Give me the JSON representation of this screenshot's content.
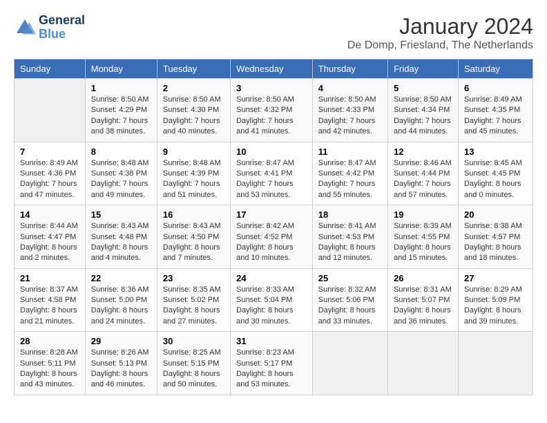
{
  "logo": {
    "line1": "General",
    "line2": "Blue"
  },
  "title": "January 2024",
  "subtitle": "De Domp, Friesland, The Netherlands",
  "days_of_week": [
    "Sunday",
    "Monday",
    "Tuesday",
    "Wednesday",
    "Thursday",
    "Friday",
    "Saturday"
  ],
  "weeks": [
    [
      {
        "num": "",
        "sunrise": "",
        "sunset": "",
        "daylight": ""
      },
      {
        "num": "1",
        "sunrise": "Sunrise: 8:50 AM",
        "sunset": "Sunset: 4:29 PM",
        "daylight": "Daylight: 7 hours and 38 minutes."
      },
      {
        "num": "2",
        "sunrise": "Sunrise: 8:50 AM",
        "sunset": "Sunset: 4:30 PM",
        "daylight": "Daylight: 7 hours and 40 minutes."
      },
      {
        "num": "3",
        "sunrise": "Sunrise: 8:50 AM",
        "sunset": "Sunset: 4:32 PM",
        "daylight": "Daylight: 7 hours and 41 minutes."
      },
      {
        "num": "4",
        "sunrise": "Sunrise: 8:50 AM",
        "sunset": "Sunset: 4:33 PM",
        "daylight": "Daylight: 7 hours and 42 minutes."
      },
      {
        "num": "5",
        "sunrise": "Sunrise: 8:50 AM",
        "sunset": "Sunset: 4:34 PM",
        "daylight": "Daylight: 7 hours and 44 minutes."
      },
      {
        "num": "6",
        "sunrise": "Sunrise: 8:49 AM",
        "sunset": "Sunset: 4:35 PM",
        "daylight": "Daylight: 7 hours and 45 minutes."
      }
    ],
    [
      {
        "num": "7",
        "sunrise": "Sunrise: 8:49 AM",
        "sunset": "Sunset: 4:36 PM",
        "daylight": "Daylight: 7 hours and 47 minutes."
      },
      {
        "num": "8",
        "sunrise": "Sunrise: 8:48 AM",
        "sunset": "Sunset: 4:38 PM",
        "daylight": "Daylight: 7 hours and 49 minutes."
      },
      {
        "num": "9",
        "sunrise": "Sunrise: 8:48 AM",
        "sunset": "Sunset: 4:39 PM",
        "daylight": "Daylight: 7 hours and 51 minutes."
      },
      {
        "num": "10",
        "sunrise": "Sunrise: 8:47 AM",
        "sunset": "Sunset: 4:41 PM",
        "daylight": "Daylight: 7 hours and 53 minutes."
      },
      {
        "num": "11",
        "sunrise": "Sunrise: 8:47 AM",
        "sunset": "Sunset: 4:42 PM",
        "daylight": "Daylight: 7 hours and 55 minutes."
      },
      {
        "num": "12",
        "sunrise": "Sunrise: 8:46 AM",
        "sunset": "Sunset: 4:44 PM",
        "daylight": "Daylight: 7 hours and 57 minutes."
      },
      {
        "num": "13",
        "sunrise": "Sunrise: 8:45 AM",
        "sunset": "Sunset: 4:45 PM",
        "daylight": "Daylight: 8 hours and 0 minutes."
      }
    ],
    [
      {
        "num": "14",
        "sunrise": "Sunrise: 8:44 AM",
        "sunset": "Sunset: 4:47 PM",
        "daylight": "Daylight: 8 hours and 2 minutes."
      },
      {
        "num": "15",
        "sunrise": "Sunrise: 8:43 AM",
        "sunset": "Sunset: 4:48 PM",
        "daylight": "Daylight: 8 hours and 4 minutes."
      },
      {
        "num": "16",
        "sunrise": "Sunrise: 8:43 AM",
        "sunset": "Sunset: 4:50 PM",
        "daylight": "Daylight: 8 hours and 7 minutes."
      },
      {
        "num": "17",
        "sunrise": "Sunrise: 8:42 AM",
        "sunset": "Sunset: 4:52 PM",
        "daylight": "Daylight: 8 hours and 10 minutes."
      },
      {
        "num": "18",
        "sunrise": "Sunrise: 8:41 AM",
        "sunset": "Sunset: 4:53 PM",
        "daylight": "Daylight: 8 hours and 12 minutes."
      },
      {
        "num": "19",
        "sunrise": "Sunrise: 8:39 AM",
        "sunset": "Sunset: 4:55 PM",
        "daylight": "Daylight: 8 hours and 15 minutes."
      },
      {
        "num": "20",
        "sunrise": "Sunrise: 8:38 AM",
        "sunset": "Sunset: 4:57 PM",
        "daylight": "Daylight: 8 hours and 18 minutes."
      }
    ],
    [
      {
        "num": "21",
        "sunrise": "Sunrise: 8:37 AM",
        "sunset": "Sunset: 4:58 PM",
        "daylight": "Daylight: 8 hours and 21 minutes."
      },
      {
        "num": "22",
        "sunrise": "Sunrise: 8:36 AM",
        "sunset": "Sunset: 5:00 PM",
        "daylight": "Daylight: 8 hours and 24 minutes."
      },
      {
        "num": "23",
        "sunrise": "Sunrise: 8:35 AM",
        "sunset": "Sunset: 5:02 PM",
        "daylight": "Daylight: 8 hours and 27 minutes."
      },
      {
        "num": "24",
        "sunrise": "Sunrise: 8:33 AM",
        "sunset": "Sunset: 5:04 PM",
        "daylight": "Daylight: 8 hours and 30 minutes."
      },
      {
        "num": "25",
        "sunrise": "Sunrise: 8:32 AM",
        "sunset": "Sunset: 5:06 PM",
        "daylight": "Daylight: 8 hours and 33 minutes."
      },
      {
        "num": "26",
        "sunrise": "Sunrise: 8:31 AM",
        "sunset": "Sunset: 5:07 PM",
        "daylight": "Daylight: 8 hours and 36 minutes."
      },
      {
        "num": "27",
        "sunrise": "Sunrise: 8:29 AM",
        "sunset": "Sunset: 5:09 PM",
        "daylight": "Daylight: 8 hours and 39 minutes."
      }
    ],
    [
      {
        "num": "28",
        "sunrise": "Sunrise: 8:28 AM",
        "sunset": "Sunset: 5:11 PM",
        "daylight": "Daylight: 8 hours and 43 minutes."
      },
      {
        "num": "29",
        "sunrise": "Sunrise: 8:26 AM",
        "sunset": "Sunset: 5:13 PM",
        "daylight": "Daylight: 8 hours and 46 minutes."
      },
      {
        "num": "30",
        "sunrise": "Sunrise: 8:25 AM",
        "sunset": "Sunset: 5:15 PM",
        "daylight": "Daylight: 8 hours and 50 minutes."
      },
      {
        "num": "31",
        "sunrise": "Sunrise: 8:23 AM",
        "sunset": "Sunset: 5:17 PM",
        "daylight": "Daylight: 8 hours and 53 minutes."
      },
      {
        "num": "",
        "sunrise": "",
        "sunset": "",
        "daylight": ""
      },
      {
        "num": "",
        "sunrise": "",
        "sunset": "",
        "daylight": ""
      },
      {
        "num": "",
        "sunrise": "",
        "sunset": "",
        "daylight": ""
      }
    ]
  ]
}
